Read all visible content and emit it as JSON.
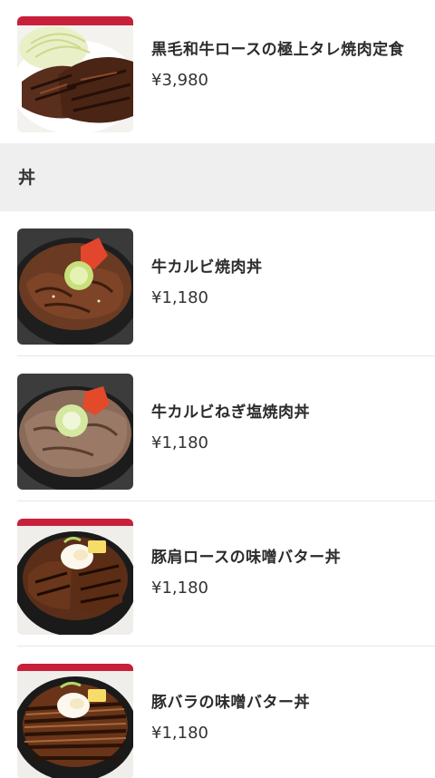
{
  "items_top": [
    {
      "name": "黒毛和牛ロースの極上タレ焼肉定食",
      "price": "¥3,980",
      "image": "beef-teishoku-photo"
    }
  ],
  "section": {
    "label": "丼"
  },
  "items": [
    {
      "name": "牛カルビ焼肉丼",
      "price": "¥1,180",
      "image": "karubi-don-photo"
    },
    {
      "name": "牛カルビねぎ塩焼肉丼",
      "price": "¥1,180",
      "image": "negi-shio-don-photo"
    },
    {
      "name": "豚肩ロースの味噌バター丼",
      "price": "¥1,180",
      "image": "pork-shoulder-miso-butter-don-photo"
    },
    {
      "name": "豚バラの味噌バター丼",
      "price": "¥1,180",
      "image": "pork-belly-miso-butter-don-photo"
    }
  ],
  "colors": {
    "section_bg": "#efefef",
    "divider": "#e6e6e6"
  }
}
